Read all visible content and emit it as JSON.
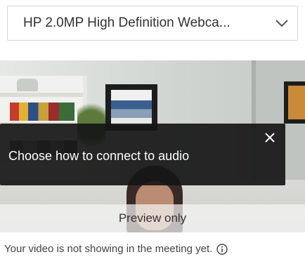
{
  "camera": {
    "selected": "HP 2.0MP High Definition Webca...",
    "chevron_icon": "chevron-down-icon"
  },
  "preview": {
    "label": "Preview only"
  },
  "tooltip": {
    "message": "Choose how to connect to audio",
    "close_icon": "close-icon"
  },
  "status": {
    "text": "Your video is not showing in the meeting yet.",
    "info_icon": "info-icon"
  },
  "colors": {
    "tooltip_bg": "#161616",
    "text": "#333333"
  }
}
